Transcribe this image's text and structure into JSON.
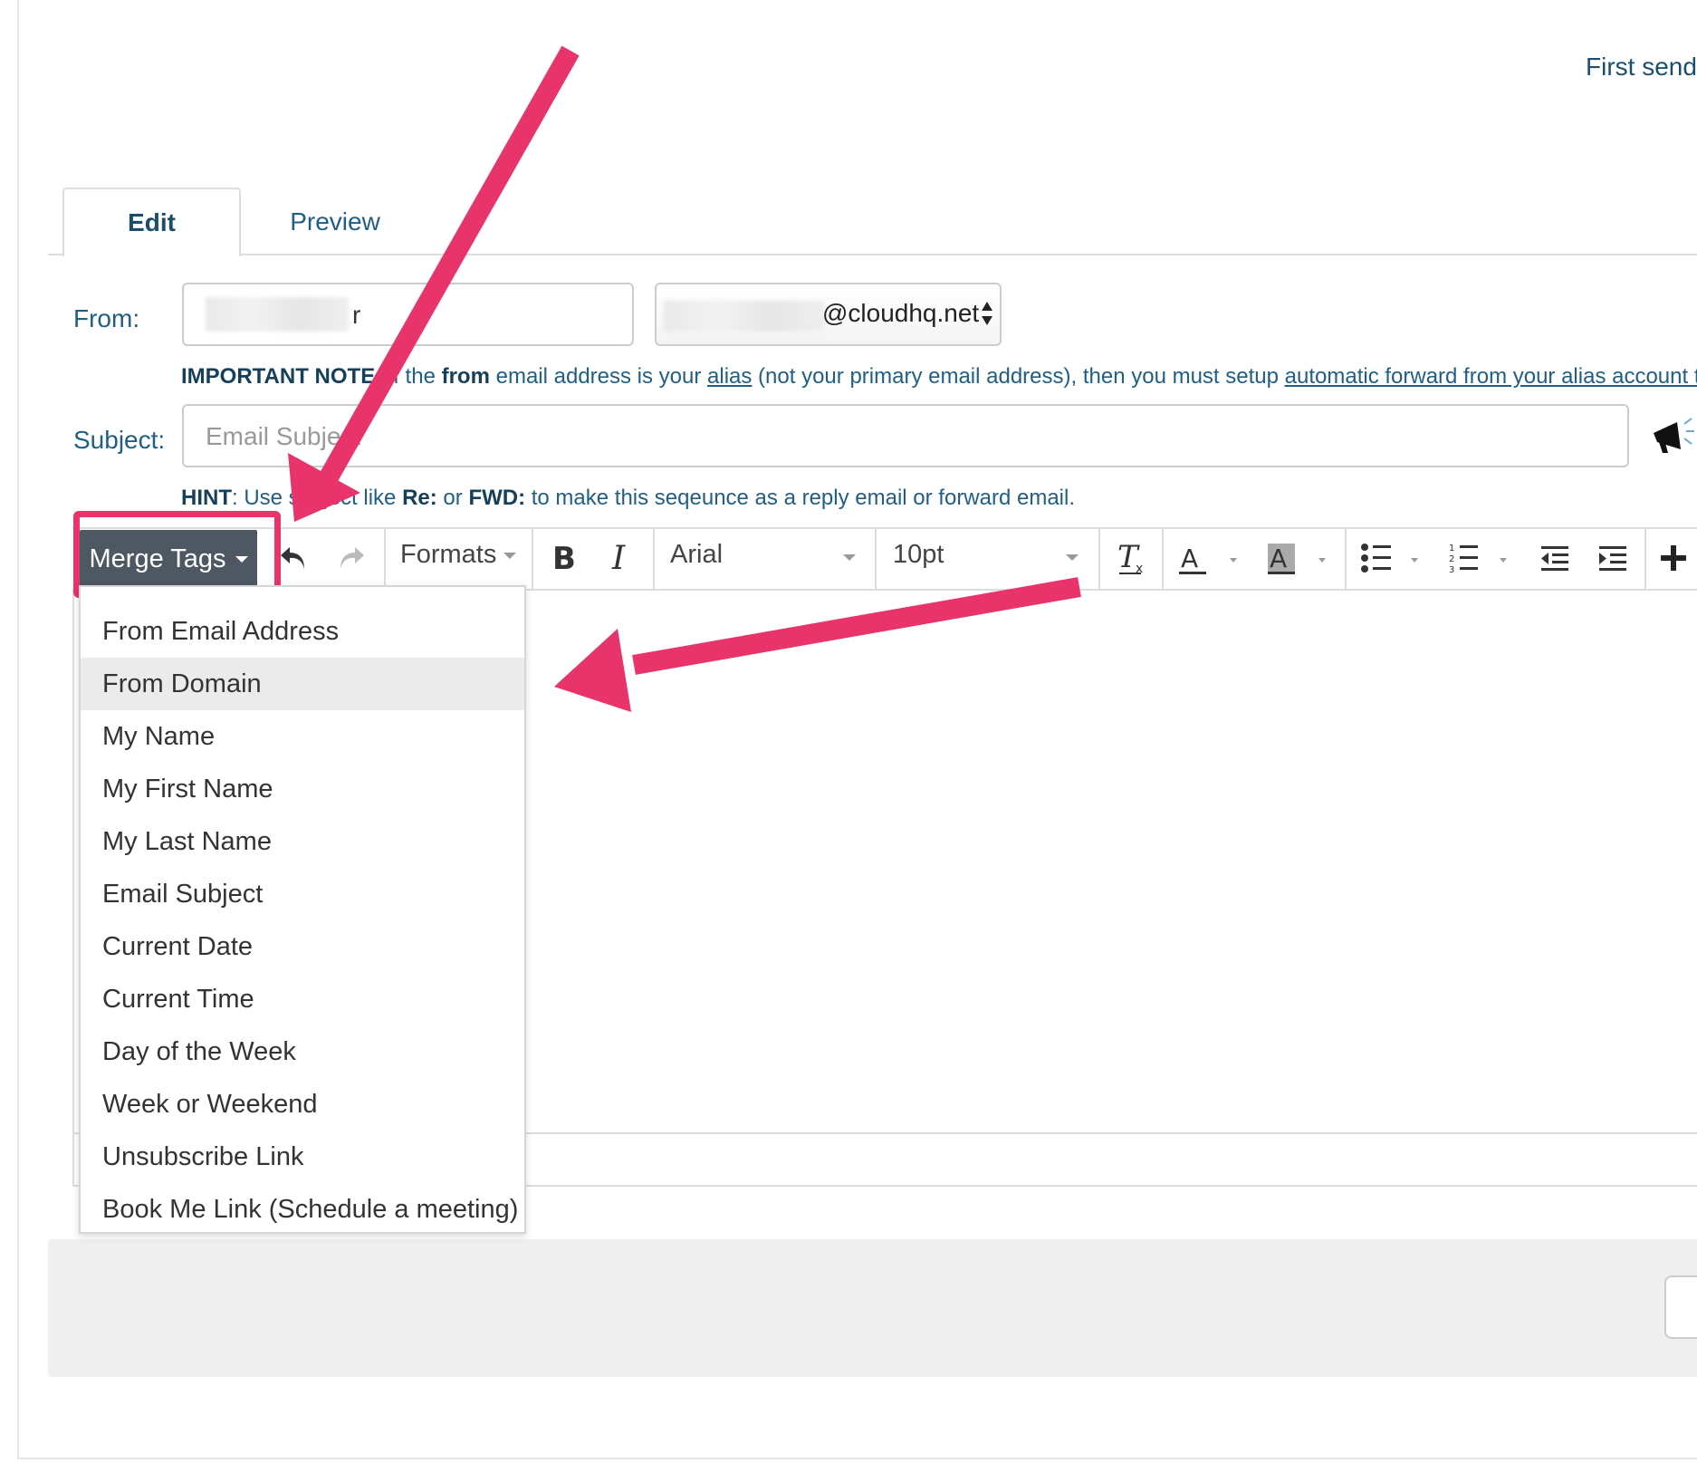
{
  "header": {
    "first_send_label": "First send"
  },
  "tabs": [
    {
      "label": "Edit",
      "active": true
    },
    {
      "label": "Preview",
      "active": false
    }
  ],
  "from": {
    "label": "From:",
    "name_visible_suffix": "r",
    "email_domain": "@cloudhq.net"
  },
  "important_note": {
    "prefix": "IMPORTANT NOTE",
    "text_a": ": If the ",
    "from_word": "from",
    "text_b": " email address is your ",
    "alias_link": "alias",
    "text_c": " (not your primary email address), then you must setup ",
    "forward_link": "automatic forward from your alias account to"
  },
  "subject": {
    "label": "Subject:",
    "placeholder": "Email Subject"
  },
  "hint": {
    "prefix": "HINT",
    "text_a": ": Use subject like ",
    "re": "Re:",
    "text_b": " or ",
    "fwd": "FWD:",
    "text_c": " to make this seqeunce as a reply email or forward email."
  },
  "toolbar": {
    "merge_tags_label": "Merge Tags",
    "formats_label": "Formats",
    "font_family": "Arial",
    "font_size": "10pt",
    "icons": [
      "undo-icon",
      "redo-icon",
      "bold-icon",
      "italic-icon",
      "clear-formatting-icon",
      "text-color-icon",
      "background-color-icon",
      "bullet-list-icon",
      "numbered-list-icon",
      "outdent-icon",
      "indent-icon",
      "insert-icon"
    ]
  },
  "merge_tags_menu": {
    "items": [
      "From Email Address",
      "From Domain",
      "My Name",
      "My First Name",
      "My Last Name",
      "Email Subject",
      "Current Date",
      "Current Time",
      "Day of the Week",
      "Week or Weekend",
      "Unsubscribe Link",
      "Book Me Link (Schedule a meeting)"
    ],
    "highlighted_index": 1
  },
  "colors": {
    "annotation": "#e8336b",
    "link_blue": "#1f5f86",
    "merge_button": "#4e5863"
  }
}
